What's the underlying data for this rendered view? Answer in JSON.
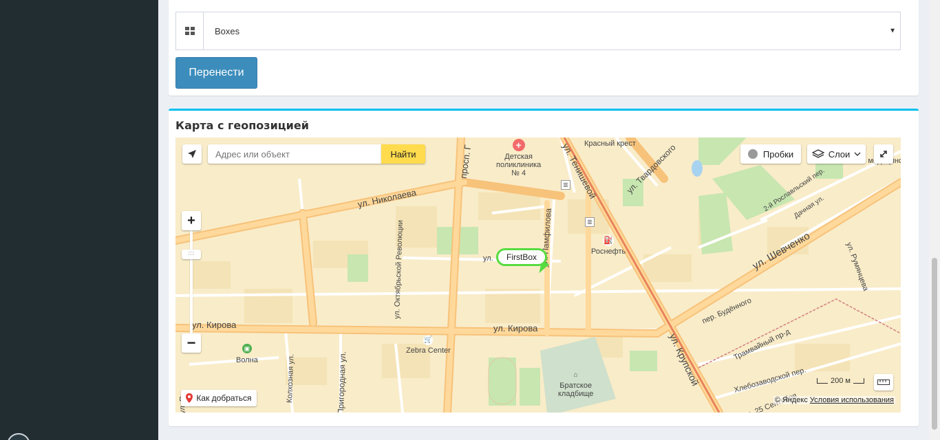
{
  "form": {
    "select_value": "Boxes",
    "select_icon": "grid-icon",
    "submit_label": "Перенести"
  },
  "map_box": {
    "title": "Карта с геопозицией"
  },
  "map": {
    "search_placeholder": "Адрес или объект",
    "search_button": "Найти",
    "traffic_label": "Пробки",
    "layers_label": "Слои",
    "route_label": "Как добраться",
    "marker_label": "FirstBox",
    "scale_label": "200 м",
    "copyright_prefix": "© Яндекс",
    "terms_link": "Условия использования",
    "streets": {
      "nikolaeva": "ул. Николаева",
      "kirova_left": "ул. Кирова",
      "kirova_center": "ул. Кирова",
      "oktyabrskoy": "ул. Октябрьской Революции",
      "prosp": "просп. Г",
      "tenisheva": "ул. Тенишевой",
      "tvardovskogo": "ул. Твардовского",
      "pamfilova": "ул. Памфилова",
      "ul_small": "ул.",
      "shevchenko": "ул. Шевченко",
      "kruspkoy": "ул. Крупской",
      "budennogo": "пер. Будённого",
      "tramvayny": "Трамвайный пр-д",
      "khlebozavodskoy": "Хлебозаводской пер.",
      "roslavlsky": "2-й Рославльский пер.",
      "dachnaya": "Дачная ул.",
      "rumyantseva": "ул. Румянцева",
      "kolkhoznaya": "Колхозная ул.",
      "prigorodnaya": "Пригородная ул.",
      "ul_p": "ул. П",
      "sentyabrya": "ул. 25 Сентября"
    },
    "pois": {
      "polyclinic": "Детская\nполиклиника\n№ 4",
      "krasny_krest": "Красный крест",
      "rosneft": "Роснефть",
      "zebra": "Zebra Center",
      "volna": "Волна",
      "bratskoe": "Братское\nкладбище",
      "rehab": "Бо\nмедицинск\nреабилитаци"
    }
  }
}
